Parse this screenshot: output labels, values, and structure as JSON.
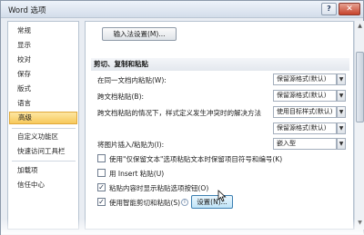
{
  "window": {
    "title": "Word 选项"
  },
  "titlebar": {
    "help_glyph": "?",
    "close_glyph": "✕"
  },
  "sidebar": {
    "items": [
      {
        "label": "常规"
      },
      {
        "label": "显示"
      },
      {
        "label": "校对"
      },
      {
        "label": "保存"
      },
      {
        "label": "版式"
      },
      {
        "label": "语言"
      },
      {
        "label": "高级",
        "selected": true
      },
      {
        "label": "自定义功能区"
      },
      {
        "label": "快速访问工具栏"
      },
      {
        "label": "加载项"
      },
      {
        "label": "信任中心"
      }
    ]
  },
  "content": {
    "input_settings_button": "输入法设置(M)...",
    "section_title": "剪切、复制和粘贴",
    "paste_options": [
      {
        "label": "在同一文档内粘贴(W):",
        "value": "保留源格式(默认)"
      },
      {
        "label": "跨文档粘贴(B):",
        "value": "保留源格式(默认)"
      },
      {
        "label": "跨文档粘贴的情况下，样式定义发生冲突时的解决方法",
        "value": "使用目标样式(默认)"
      },
      {
        "label": "",
        "value": "保留源格式(默认)"
      },
      {
        "label": "将图片插入/粘贴为(I):",
        "value": "嵌入型"
      }
    ],
    "checkboxes": [
      {
        "label": "使用\"仅保留文本\"选项粘贴文本时保留项目符号和编号(K)",
        "checked": false
      },
      {
        "label": "用 Insert 粘贴(U)",
        "checked": false
      },
      {
        "label": "粘贴内容时显示粘贴选项按钮(O)",
        "checked": true
      },
      {
        "label": "使用智能剪切和粘贴(S)",
        "checked": true
      }
    ],
    "settings_button": "设置(N)..."
  },
  "scrollbar": {
    "up_glyph": "▲",
    "down_glyph": "▼"
  },
  "dropdown_glyph": "▼",
  "check_glyph": "✓",
  "info_glyph": "i"
}
